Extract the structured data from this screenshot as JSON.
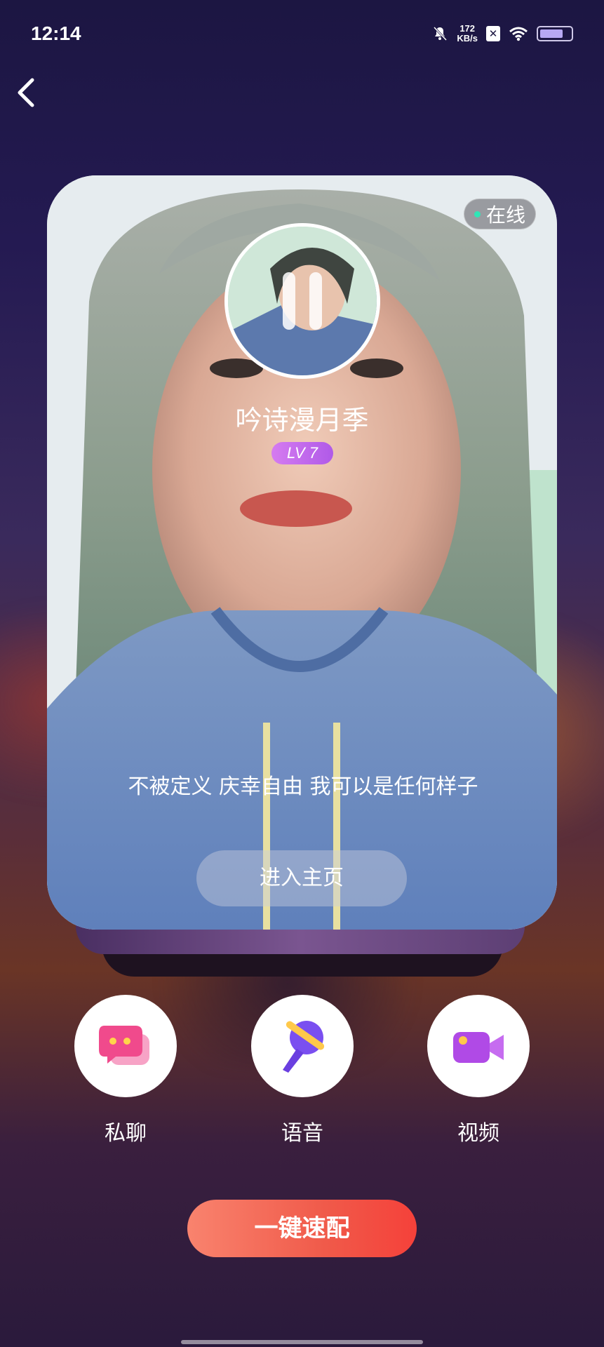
{
  "status_bar": {
    "time": "12:14",
    "net_speed_value": "172",
    "net_speed_unit": "KB/s",
    "icons": [
      "mute-bell-icon",
      "sim-x-icon",
      "wifi-icon",
      "battery-icon"
    ]
  },
  "nav": {
    "back_icon": "chevron-left-icon"
  },
  "profile": {
    "status": "在线",
    "name": "吟诗漫月季",
    "level": "LV 7",
    "bio": "不被定义  庆幸自由  我可以是任何样子",
    "enter_label": "进入主页"
  },
  "actions": [
    {
      "label": "私聊",
      "icon": "chat-bubbles-icon",
      "color": "#f04a8c"
    },
    {
      "label": "语音",
      "icon": "voice-microphone-icon",
      "color": "#7a4ff0"
    },
    {
      "label": "视频",
      "icon": "video-camera-icon",
      "color": "#b04ae6"
    }
  ],
  "match_button": {
    "label": "一键速配"
  },
  "colors": {
    "accent_pink": "#f04a8c",
    "accent_purple": "#b05ae8",
    "match_orange": "#f5413a",
    "online_green": "#2fe6b6"
  }
}
